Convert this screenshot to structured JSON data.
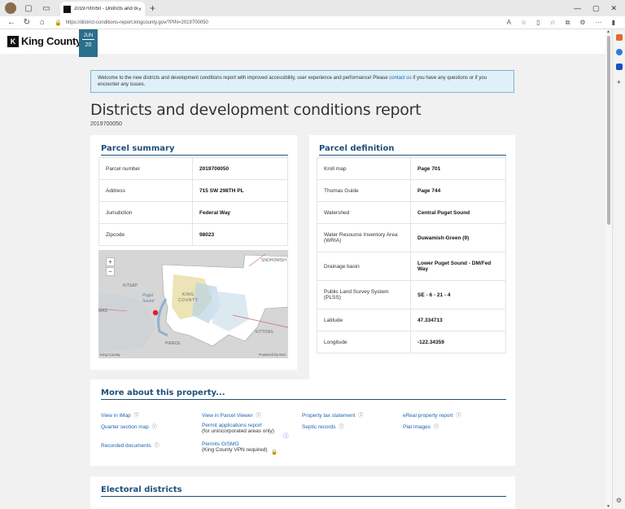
{
  "browser": {
    "tab_title": "2019700050 - Districts and dev",
    "url": "https://district-conditions-report.kingcounty.gov/?PIN=2019700050"
  },
  "header": {
    "logo_text": "King County",
    "date_month": "JUN",
    "date_day": "20"
  },
  "banner": {
    "text_before": "Welcome to the new districts and development conditions report with improved accessibility, user experience and performance! Please ",
    "link_text": "contact us",
    "text_after": " if you have any questions or if you encounter any issues."
  },
  "page": {
    "title": "Districts and development conditions report",
    "subtitle": "2019700050"
  },
  "parcel_summary": {
    "heading": "Parcel summary",
    "rows": [
      {
        "label": "Parcel number",
        "value": "2019700050"
      },
      {
        "label": "Address",
        "value": "715 SW 298TH PL"
      },
      {
        "label": "Jurisdiction",
        "value": "Federal Way"
      },
      {
        "label": "Zipcode",
        "value": "98023"
      }
    ]
  },
  "map": {
    "zoom_in": "+",
    "zoom_out": "−",
    "labels": {
      "kitsap": "KITSAP",
      "puget": "Puget",
      "sound": "Sound",
      "king": "KING",
      "county": "COUNTY",
      "snohomish": "SNOHOMISH",
      "kittitas": "KITTITAS",
      "pierce": "PIERCE",
      "mason": "MAS"
    },
    "attribution_left": "King County",
    "attribution_right": "Powered by Esri"
  },
  "parcel_definition": {
    "heading": "Parcel definition",
    "rows": [
      {
        "label": "Kroll map",
        "value": "Page 701"
      },
      {
        "label": "Thomas Guide",
        "value": "Page 744"
      },
      {
        "label": "Watershed",
        "value": "Central Puget Sound"
      },
      {
        "label": "Water Resource Inventory Area (WRIA)",
        "value": "Duwamish-Green (9)"
      },
      {
        "label": "Drainage basin",
        "value": "Lower Puget Sound - DM/Fed Way"
      },
      {
        "label": "Public Land Survey System (PLSS)",
        "value": "SE - 6 - 21 - 4"
      },
      {
        "label": "Latitude",
        "value": "47.334713"
      },
      {
        "label": "Longitude",
        "value": "-122.34359"
      }
    ]
  },
  "more": {
    "heading": "More about this property...",
    "help_glyph": "ⓘ",
    "vpn_glyph": "🔒",
    "items": {
      "imap": "View in iMap",
      "parcel_viewer": "View in Parcel Viewer",
      "tax": "Property tax statement",
      "ereal": "eReal property report",
      "quarter": "Quarter section map",
      "permit_apps": "Permit applications report",
      "permit_apps_note": "(for unincorporated areas only)",
      "septic": "Septic records",
      "plat": "Plat images",
      "recorded": "Recorded documents",
      "gismo": "Permits GISMO",
      "gismo_note": "(King County VPN required)"
    }
  },
  "electoral": {
    "heading": "Electoral districts"
  },
  "colors": {
    "accent": "#1e4f7a",
    "link": "#1a63b5",
    "badge": "#2b6f8a",
    "map_marker": "#e0201f"
  }
}
